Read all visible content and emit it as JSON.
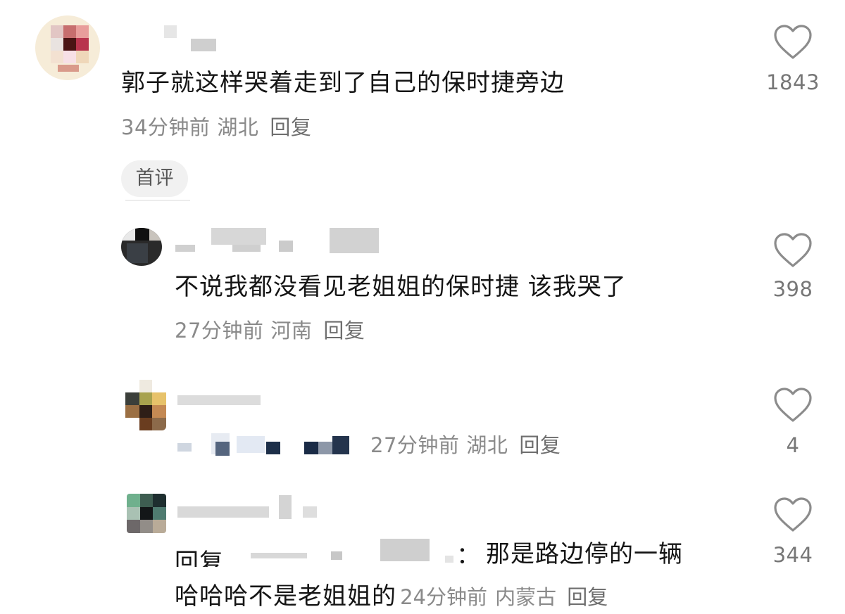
{
  "comments": [
    {
      "text": "郭子就这样哭着走到了自己的保时捷旁边",
      "time": "34分钟前",
      "location": "湖北",
      "reply_label": "回复",
      "badge": "首评",
      "likes": "1843"
    },
    {
      "text": "不说我都没看见老姐姐的保时捷 该我哭了",
      "time": "27分钟前",
      "location": "河南",
      "reply_label": "回复",
      "likes": "398"
    },
    {
      "time": "27分钟前",
      "location": "湖北",
      "reply_label": "回复",
      "likes": "4"
    },
    {
      "reply_prefix": "回复",
      "colon": "：",
      "text_line1": "那是路边停的一辆",
      "text_line2": "哈哈哈不是老姐姐的",
      "time": "24分钟前",
      "location": "内蒙古",
      "reply_label": "回复",
      "likes": "344"
    }
  ],
  "icons": {
    "like": "heart-outline-icon"
  },
  "colors": {
    "text": "#151515",
    "meta": "#8a8a8a",
    "icon": "#8c8c8c",
    "badge_bg": "#f1f1f1"
  }
}
